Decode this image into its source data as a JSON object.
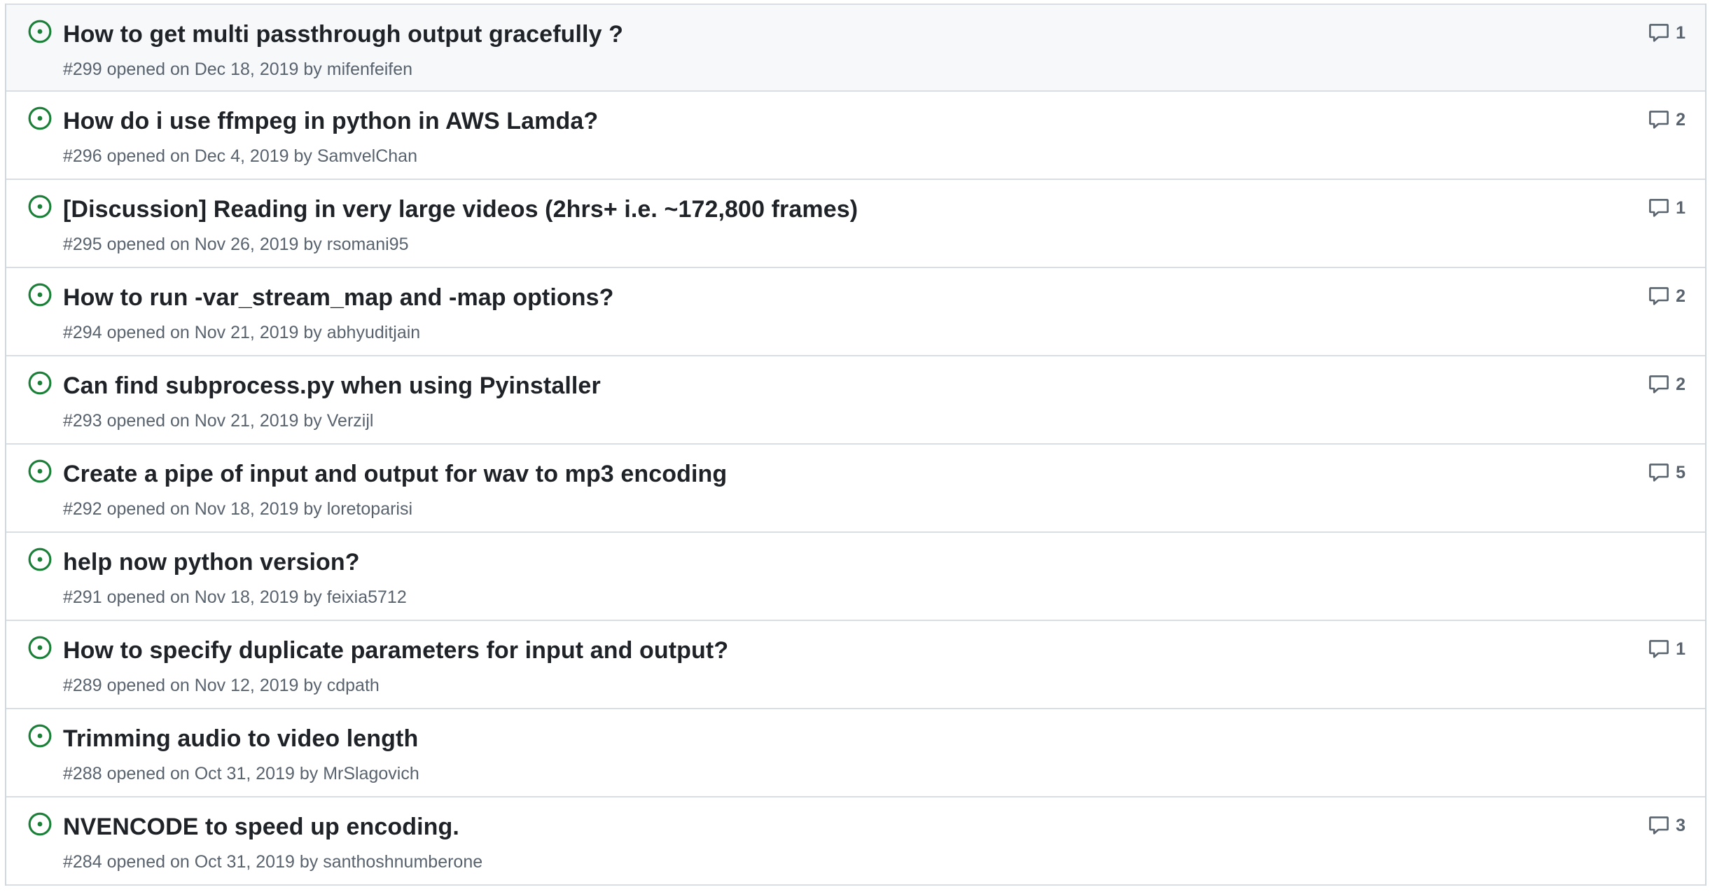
{
  "colors": {
    "open_icon": "#1a7f37",
    "meta_text": "#59636e",
    "title_text": "#1f2328",
    "row_border": "#d8dee4",
    "hover_bg": "#f6f8fa"
  },
  "issues": [
    {
      "title": "How to get multi passthrough output gracefully ?",
      "number": "#299",
      "opened": "opened on",
      "date": "Dec 18, 2019",
      "by": "by",
      "author": "mifenfeifen",
      "comments": "1",
      "icon": "issue-opened-icon"
    },
    {
      "title": "How do i use ffmpeg in python in AWS Lamda?",
      "number": "#296",
      "opened": "opened on",
      "date": "Dec 4, 2019",
      "by": "by",
      "author": "SamvelChan",
      "comments": "2",
      "icon": "issue-opened-icon"
    },
    {
      "title": "[Discussion] Reading in very large videos (2hrs+ i.e. ~172,800 frames)",
      "number": "#295",
      "opened": "opened on",
      "date": "Nov 26, 2019",
      "by": "by",
      "author": "rsomani95",
      "comments": "1",
      "icon": "issue-opened-icon"
    },
    {
      "title": "How to run -var_stream_map and -map options?",
      "number": "#294",
      "opened": "opened on",
      "date": "Nov 21, 2019",
      "by": "by",
      "author": "abhyuditjain",
      "comments": "2",
      "icon": "issue-opened-icon"
    },
    {
      "title": "Can find subprocess.py when using Pyinstaller",
      "number": "#293",
      "opened": "opened on",
      "date": "Nov 21, 2019",
      "by": "by",
      "author": "Verzijl",
      "comments": "2",
      "icon": "issue-opened-icon"
    },
    {
      "title": "Create a pipe of input and output for wav to mp3 encoding",
      "number": "#292",
      "opened": "opened on",
      "date": "Nov 18, 2019",
      "by": "by",
      "author": "loretoparisi",
      "comments": "5",
      "icon": "issue-opened-icon"
    },
    {
      "title": "help now python version?",
      "number": "#291",
      "opened": "opened on",
      "date": "Nov 18, 2019",
      "by": "by",
      "author": "feixia5712",
      "comments": "",
      "icon": "issue-opened-icon"
    },
    {
      "title": "How to specify duplicate parameters for input and output?",
      "number": "#289",
      "opened": "opened on",
      "date": "Nov 12, 2019",
      "by": "by",
      "author": "cdpath",
      "comments": "1",
      "icon": "issue-opened-icon"
    },
    {
      "title": "Trimming audio to video length",
      "number": "#288",
      "opened": "opened on",
      "date": "Oct 31, 2019",
      "by": "by",
      "author": "MrSlagovich",
      "comments": "",
      "icon": "issue-opened-icon"
    },
    {
      "title": "NVENCODE to speed up encoding.",
      "number": "#284",
      "opened": "opened on",
      "date": "Oct 31, 2019",
      "by": "by",
      "author": "santhoshnumberone",
      "comments": "3",
      "icon": "issue-opened-icon"
    }
  ]
}
